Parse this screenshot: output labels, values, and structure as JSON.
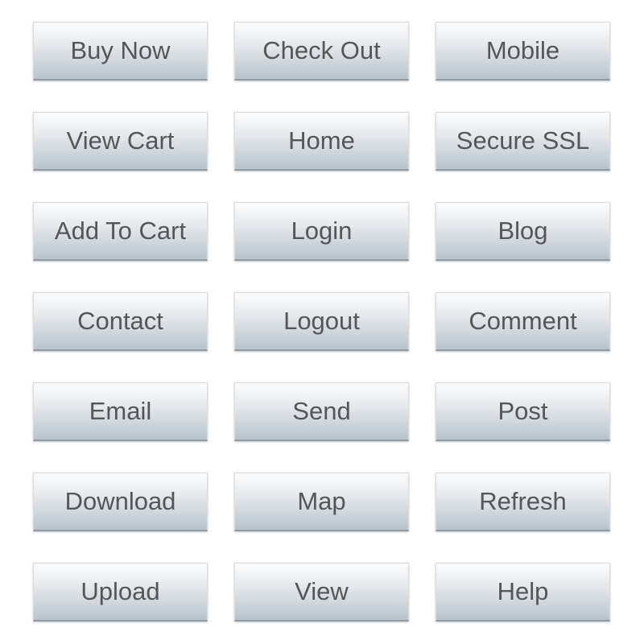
{
  "buttons": [
    "Buy Now",
    "Check Out",
    "Mobile",
    "View Cart",
    "Home",
    "Secure SSL",
    "Add To Cart",
    "Login",
    "Blog",
    "Contact",
    "Logout",
    "Comment",
    "Email",
    "Send",
    "Post",
    "Download",
    "Map",
    "Refresh",
    "Upload",
    "View",
    "Help"
  ]
}
